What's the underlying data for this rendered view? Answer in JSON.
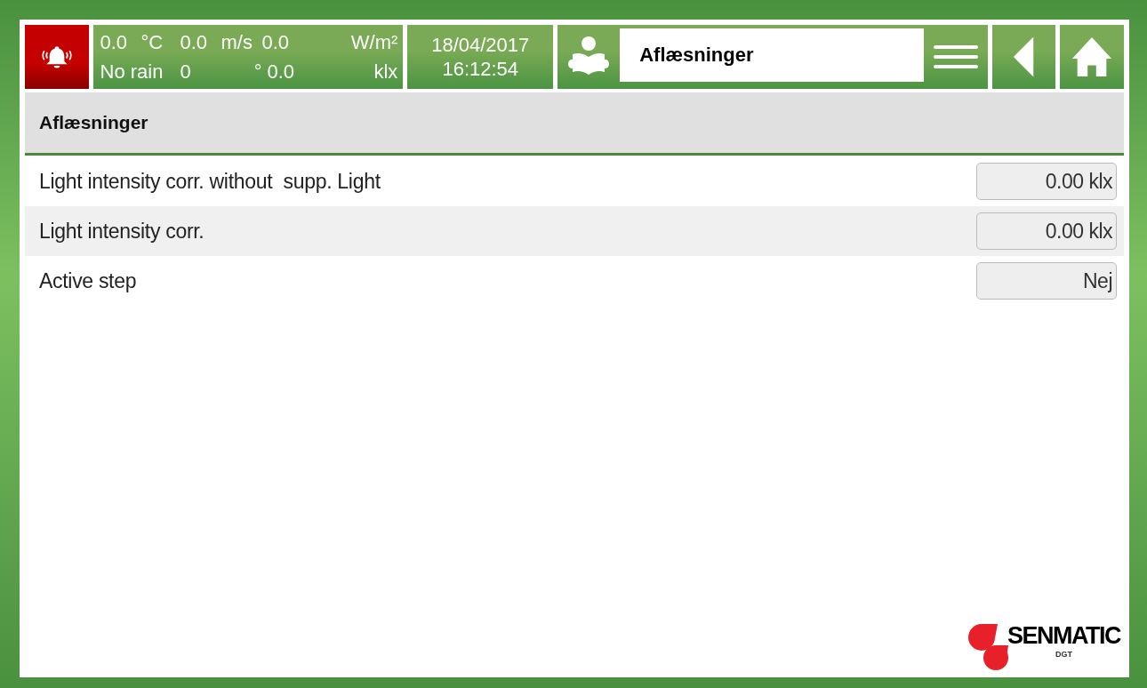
{
  "alarm": {
    "active": true
  },
  "weather": {
    "temperature": "0.0",
    "temperature_unit": "°C",
    "wind_speed": "0.0",
    "wind_speed_unit": "m/s",
    "radiation": "0.0",
    "radiation_unit": "W/m²",
    "rain": "No rain",
    "wind_direction": "0",
    "wind_direction_unit": "°",
    "light": "0.0",
    "light_unit": "klx"
  },
  "clock": {
    "date": "18/04/2017",
    "time": "16:12:54"
  },
  "title_field": {
    "value": "Aflæsninger"
  },
  "section": {
    "title": "Aflæsninger"
  },
  "readings": [
    {
      "label": "Light intensity corr. without  supp. Light",
      "value": "0.00 klx"
    },
    {
      "label": "Light intensity corr.",
      "value": "0.00 klx"
    },
    {
      "label": "Active step",
      "value": "Nej"
    }
  ],
  "logo": {
    "name": "SENMATIC",
    "sub": "DGT"
  }
}
